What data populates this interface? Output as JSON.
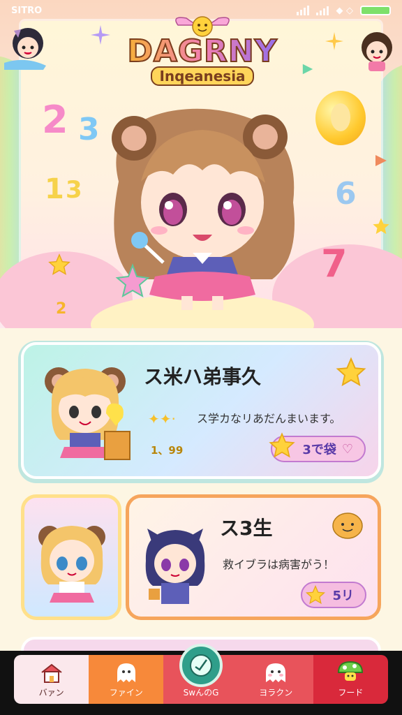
{
  "status_bar": {
    "carrier": "SITRO",
    "wifi_label": "◆ ◇"
  },
  "hero": {
    "logo_title": "DAGRNY",
    "logo_subtitle": "Inqeanesia",
    "floating_numbers": [
      "2",
      "3",
      "1",
      "3",
      "6",
      "7",
      "2",
      "0"
    ]
  },
  "featured_card": {
    "title": "ス米ハ弟事久",
    "description": "ス学カなリあだんまいます。",
    "counter": "1、99",
    "pill_label": "3で袋",
    "star_icon": "star-icon"
  },
  "second_card": {
    "title": "ス3生",
    "description": "救イブラは病害がう！",
    "pill_label": "5リ"
  },
  "bottom_nav": {
    "items": [
      {
        "label": "バァン",
        "icon": "house-icon"
      },
      {
        "label": "ファイン",
        "icon": "ghost-icon"
      },
      {
        "label": "SwんのG",
        "icon": "clock-icon"
      },
      {
        "label": "ヨラクン",
        "icon": "ghost-icon"
      },
      {
        "label": "フード",
        "icon": "mushroom-icon"
      }
    ]
  },
  "colors": {
    "nav_home": "#fbe8ec",
    "nav_orange": "#f7893a",
    "nav_red": "#e8535b",
    "nav_dark_red": "#d9293b",
    "featured_gradient_start": "#bdf3e6",
    "second_card_border": "#f6a55c",
    "thumb_border": "#ffe08a"
  }
}
